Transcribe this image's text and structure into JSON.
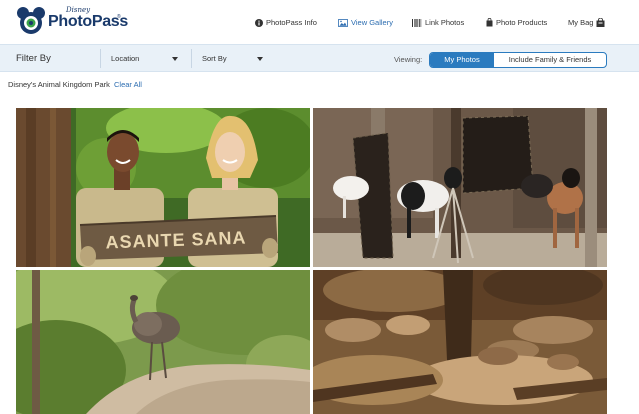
{
  "brand": {
    "disney": "Disney",
    "name": "PhotoPass",
    "tm": "®"
  },
  "nav": {
    "info": "PhotoPass Info",
    "gallery": "View Gallery",
    "link": "Link Photos",
    "products": "Photo Products",
    "bag": "My Bag"
  },
  "filters": {
    "title": "Filter By",
    "location": "Location",
    "sort": "Sort By",
    "viewing_label": "Viewing:",
    "my_photos": "My Photos",
    "family": "Include Family & Friends"
  },
  "breadcrumb": {
    "park": "Disney's Animal Kingdom Park",
    "clear": "Clear All"
  },
  "photos": [
    {
      "sign_text": "ASANTE SANA"
    },
    {},
    {},
    {}
  ],
  "colors": {
    "brand_navy": "#1a3a6b",
    "accent_blue": "#2b7bbf",
    "link_blue": "#2b6cb0",
    "filter_bg": "#e9f1f8"
  }
}
